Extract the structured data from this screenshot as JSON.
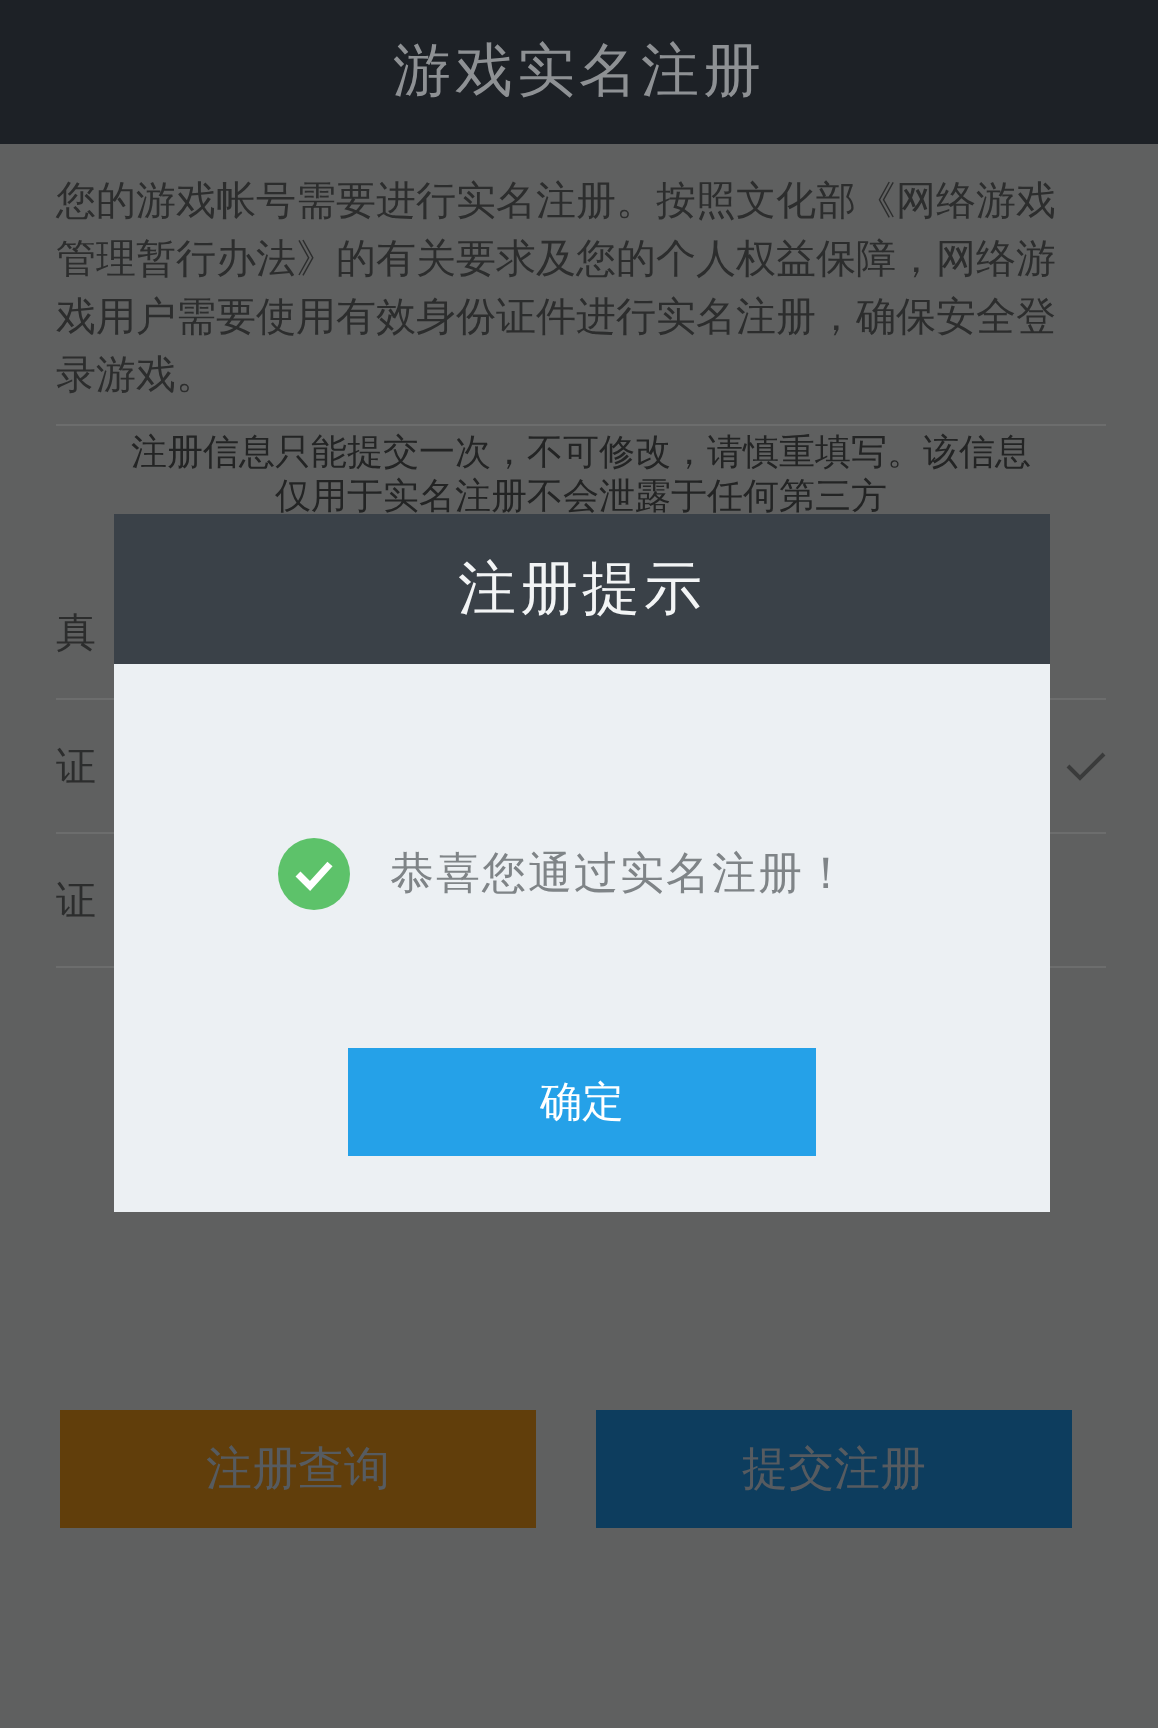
{
  "header": {
    "title": "游戏实名注册"
  },
  "intro": "您的游戏帐号需要进行实名注册。按照文化部《网络游戏管理暂行办法》的有关要求及您的个人权益保障，网络游戏用户需要使用有效身份证件进行实名注册，确保安全登录游戏。",
  "notice": "注册信息只能提交一次，不可修改，请慎重填写。该信息仅用于实名注册不会泄露于任何第三方",
  "form_rows": [
    {
      "label": "真",
      "verified": false
    },
    {
      "label": "证",
      "verified": true
    },
    {
      "label": "证",
      "verified": false
    }
  ],
  "buttons": [
    {
      "label": "注册查询",
      "kind": "query"
    },
    {
      "label": "提交注册",
      "kind": "submit"
    }
  ],
  "dialog": {
    "title": "注册提示",
    "message": "恭喜您通过实名注册！",
    "confirm": "确定"
  }
}
